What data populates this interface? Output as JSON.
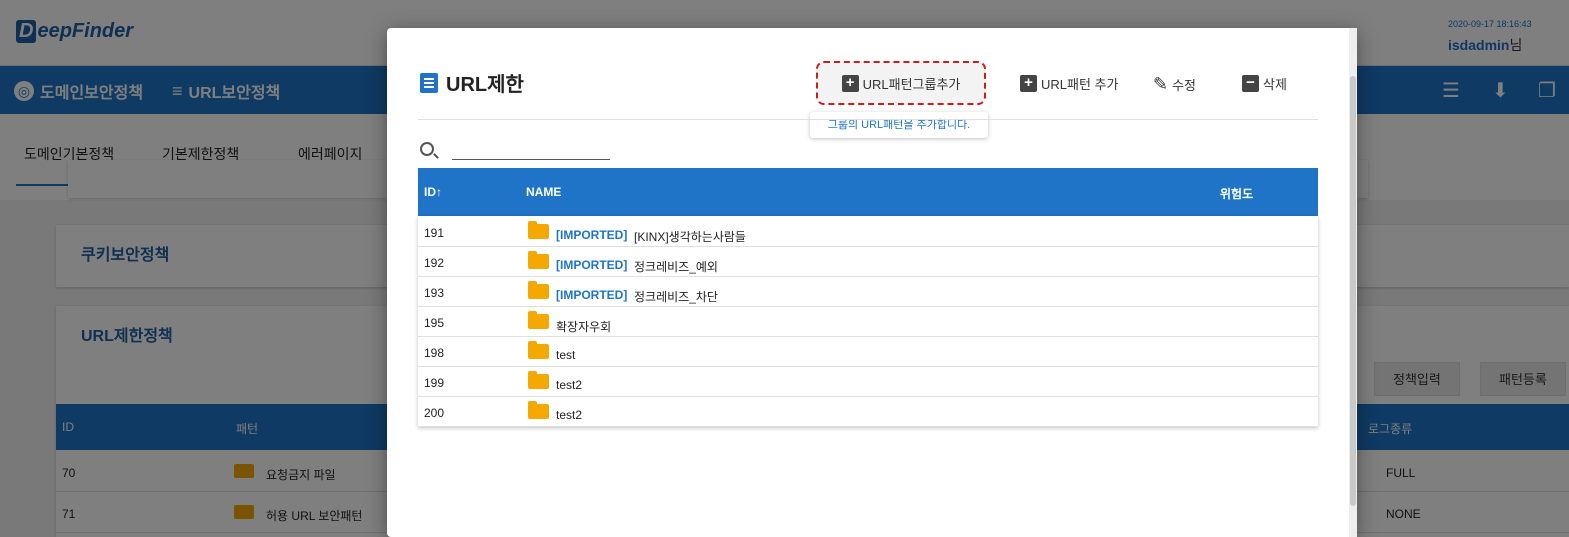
{
  "app": {
    "logo": "eepFinder",
    "logo_letter": "D",
    "datetime": "2020-09-17 18:16:43",
    "user": "isdadmin",
    "user_suffix": "님"
  },
  "nav": {
    "domain_policy": "도메인보안정책",
    "url_policy": "URL보안정책"
  },
  "subnav": {
    "tabs": [
      "도메인기본정책",
      "기본제한정책",
      "에러페이지"
    ]
  },
  "background": {
    "cookie_title": "쿠키보안정책",
    "url_restrict_title": "URL제한정책",
    "policy_input_btn": "정책입력",
    "pattern_register_btn": "패턴등록",
    "table_headers": {
      "id": "ID",
      "pattern": "패턴",
      "log_type": "로그종류"
    },
    "rows": [
      {
        "id": "70",
        "name": "요청금지 파일",
        "log": "FULL"
      },
      {
        "id": "71",
        "name": "허용 URL 보안패턴",
        "log": "NONE"
      }
    ]
  },
  "modal": {
    "title": "URL제한",
    "add_group_btn": "URL패턴그룹추가",
    "add_pattern_btn": "URL패턴 추가",
    "edit_btn": "수정",
    "delete_btn": "삭제",
    "tooltip": "그룹의 URL패턴을 추가합니다.",
    "search_placeholder": "",
    "headers": {
      "id": "ID",
      "name": "NAME",
      "risk": "위험도"
    },
    "rows": [
      {
        "id": "191",
        "tag": "[IMPORTED]",
        "name": "[KINX]생각하는사람들"
      },
      {
        "id": "192",
        "tag": "[IMPORTED]",
        "name": "정크레비즈_예외"
      },
      {
        "id": "193",
        "tag": "[IMPORTED]",
        "name": "정크레비즈_차단"
      },
      {
        "id": "195",
        "tag": "",
        "name": "확장자우회"
      },
      {
        "id": "198",
        "tag": "",
        "name": "test"
      },
      {
        "id": "199",
        "tag": "",
        "name": "test2"
      },
      {
        "id": "200",
        "tag": "",
        "name": "test2"
      }
    ]
  }
}
